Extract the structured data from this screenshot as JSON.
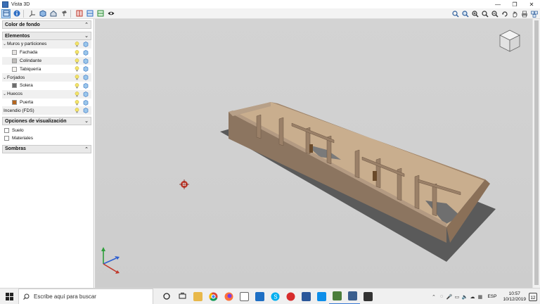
{
  "window": {
    "title": "Vista 3D",
    "minimize": "—",
    "maximize": "❐",
    "close": "✕"
  },
  "panel": {
    "sections": {
      "background": {
        "label": "Color de fondo"
      },
      "elements": {
        "label": "Elementos"
      },
      "view_options": {
        "label": "Opciones de visualización"
      },
      "shadows": {
        "label": "Sombras"
      }
    },
    "tree": [
      {
        "label": "Muros y particiones",
        "level": 0,
        "expanded": true
      },
      {
        "label": "Fachada",
        "level": 1,
        "swatch": "#e6e4e2"
      },
      {
        "label": "Colindante",
        "level": 1,
        "swatch": "#bdbbb8"
      },
      {
        "label": "Tabiquería",
        "level": 1,
        "swatch": "#f6f4f0"
      },
      {
        "label": "Forjados",
        "level": 0,
        "expanded": true
      },
      {
        "label": "Solera",
        "level": 1,
        "swatch": "#6d6d6d"
      },
      {
        "label": "Huecos",
        "level": 0,
        "expanded": true
      },
      {
        "label": "Puerta",
        "level": 1,
        "swatch": "#b5651d"
      },
      {
        "label": "Incendio (FDS)",
        "level": -1
      }
    ],
    "view_options": [
      {
        "label": "Suelo",
        "checked": false
      },
      {
        "label": "Materiales",
        "checked": false
      }
    ]
  },
  "taskbar": {
    "search_placeholder": "Escribe aquí para buscar",
    "language": "ESP",
    "time": "10:57",
    "date": "10/12/2019",
    "notifications": "12"
  },
  "colors": {
    "viewport_bg": "#d1d1d1",
    "wall": "#8c7560",
    "wall_light": "#b39a82",
    "floor_shadow": "#555555",
    "accent": "#3a6fb5"
  }
}
